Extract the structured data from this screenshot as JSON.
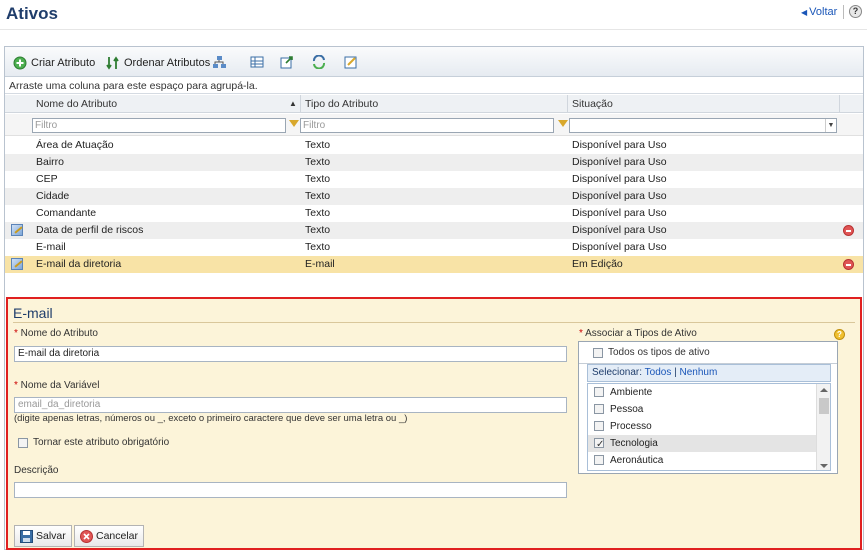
{
  "header": {
    "title": "Ativos",
    "back_label": "Voltar",
    "help_label": "?"
  },
  "toolbar": {
    "create_label": "Criar Atributo",
    "order_label": "Ordenar Atributos"
  },
  "grid": {
    "grouping_hint": "Arraste uma coluna para este espaço para agrupá-la.",
    "columns": [
      "Nome do Atributo",
      "Tipo do Atributo",
      "Situação"
    ],
    "filter_placeholder": "Filtro",
    "rows": [
      {
        "name": "Área de Atuação",
        "type": "Texto",
        "status": "Disponível para Uso"
      },
      {
        "name": "Bairro",
        "type": "Texto",
        "status": "Disponível para Uso"
      },
      {
        "name": "CEP",
        "type": "Texto",
        "status": "Disponível para Uso"
      },
      {
        "name": "Cidade",
        "type": "Texto",
        "status": "Disponível para Uso"
      },
      {
        "name": "Comandante",
        "type": "Texto",
        "status": "Disponível para Uso"
      },
      {
        "name": "Data de perfil de riscos",
        "type": "Texto",
        "status": "Disponível para Uso"
      },
      {
        "name": "E-mail",
        "type": "Texto",
        "status": "Disponível para Uso"
      },
      {
        "name": "E-mail da diretoria",
        "type": "E-mail",
        "status": "Em Edição"
      }
    ]
  },
  "form": {
    "title": "E-mail",
    "name_label": "Nome do Atributo",
    "name_value": "E-mail da diretoria",
    "var_label": "Nome da Variável",
    "var_placeholder": "email_da_diretoria",
    "var_hint": "(digite apenas letras, números ou _, exceto o primeiro caractere que deve ser uma letra ou _)",
    "required_label": "Tornar este atributo obrigatório",
    "desc_label": "Descrição",
    "assoc_label": "Associar a Tipos de Ativo",
    "all_types_label": "Todos os tipos de ativo",
    "select_label": "Selecionar:",
    "select_all": "Todos",
    "select_sep": "|",
    "select_none": "Nenhum",
    "types": [
      {
        "label": "Ambiente",
        "checked": false
      },
      {
        "label": "Pessoa",
        "checked": false
      },
      {
        "label": "Processo",
        "checked": false
      },
      {
        "label": "Tecnologia",
        "checked": true
      },
      {
        "label": "Aeronáutica",
        "checked": false
      }
    ],
    "save_label": "Salvar",
    "cancel_label": "Cancelar"
  }
}
